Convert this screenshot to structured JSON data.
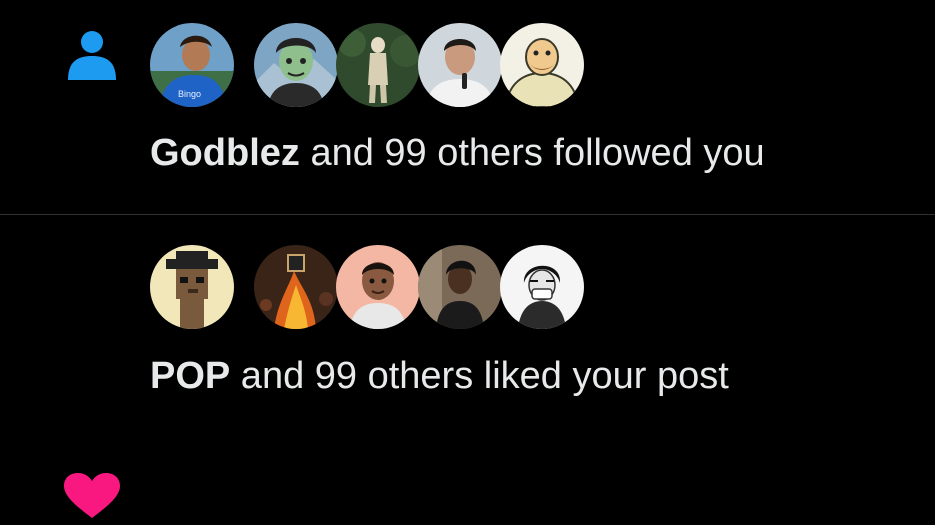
{
  "colors": {
    "background": "#000000",
    "text": "#e7e9ea",
    "follow_icon": "#1d9bf0",
    "like_icon": "#f91880",
    "divider": "#2f3336"
  },
  "notifications": [
    {
      "type": "follow",
      "icon": "person-icon",
      "actor": "Godblez",
      "rest": " and 99 others followed you",
      "avatars": [
        "footballer-avatar",
        "cartoon-man-avatar",
        "anime-figure-avatar",
        "speaker-avatar",
        "cartoon-bald-man-avatar"
      ]
    },
    {
      "type": "like",
      "icon": "heart-icon",
      "actor": "POP",
      "rest": " and 99 others liked your post",
      "avatars": [
        "pixel-punk-avatar",
        "fire-art-avatar",
        "3d-character-avatar",
        "woman-portrait-avatar",
        "sketch-mask-avatar"
      ]
    }
  ]
}
